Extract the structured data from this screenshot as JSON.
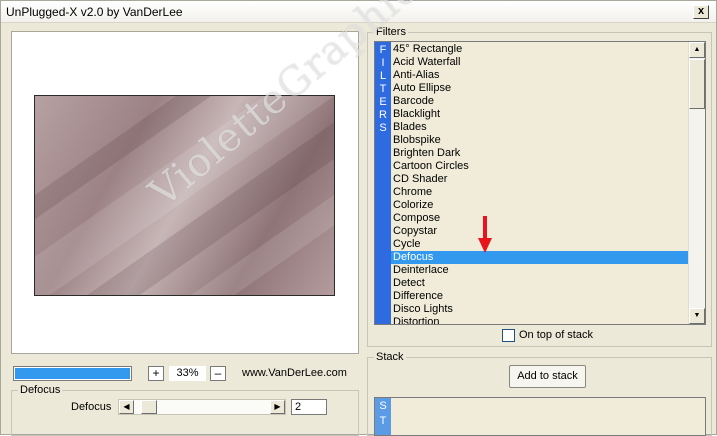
{
  "window": {
    "title": "UnPlugged-X v2.0 by VanDerLee",
    "close_label": "x"
  },
  "preview": {
    "progress_percent": 98,
    "zoom_plus": "+",
    "zoom_value": "33%",
    "zoom_minus": "–",
    "website": "www.VanDerLee.com"
  },
  "parameters": {
    "group_label": "Defocus",
    "param_label": "Defocus",
    "left_arrow": "◀",
    "right_arrow": "▶",
    "value": "2"
  },
  "filters": {
    "group_label": "Filters",
    "strip_letters": [
      "F",
      "I",
      "L",
      "T",
      "E",
      "R",
      "S"
    ],
    "items": [
      "45° Rectangle",
      "Acid Waterfall",
      "Anti-Alias",
      "Auto Ellipse",
      "Barcode",
      "Blacklight",
      "Blades",
      "Blobspike",
      "Brighten Dark",
      "Cartoon Circles",
      "CD Shader",
      "Chrome",
      "Colorize",
      "Compose",
      "Copystar",
      "Cycle",
      "Defocus",
      "Deinterlace",
      "Detect",
      "Difference",
      "Disco Lights",
      "Distortion"
    ],
    "selected": "Defocus",
    "scroll_up": "▲",
    "scroll_down": "▼",
    "on_top_label": "On top of stack"
  },
  "stack": {
    "group_label": "Stack",
    "add_button": "Add to stack",
    "strip_letters": [
      "S",
      "T"
    ]
  },
  "watermark": "VioletteGraphic",
  "colors": {
    "selection": "#3399ee",
    "strip": "#2e6be0",
    "arrow": "#e8141b"
  }
}
